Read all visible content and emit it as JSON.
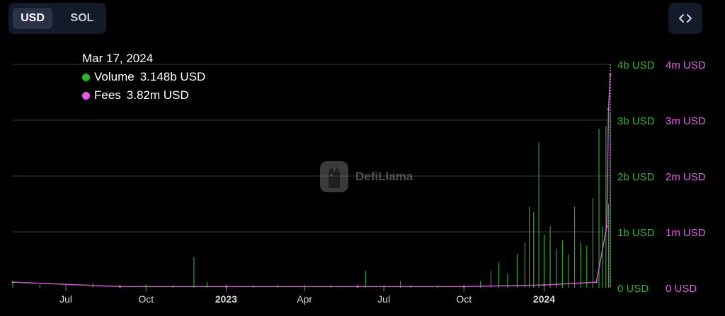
{
  "toggle": {
    "usd_label": "USD",
    "sol_label": "SOL",
    "active": "USD"
  },
  "embed_icon": "code-brackets-icon",
  "tooltip": {
    "date": "Mar 17, 2024",
    "volume_label": "Volume",
    "volume_value": "3.148b USD",
    "fees_label": "Fees",
    "fees_value": "3.82m USD"
  },
  "watermark": {
    "text": "DefiLlama",
    "icon": "llama-logo-icon"
  },
  "colors": {
    "volume": "#22b82a",
    "fees": "#e65ce6",
    "grid": "#3a3a3a",
    "background": "#000000"
  },
  "chart_data": {
    "type": "bar",
    "x_start": "2022-05-01",
    "x_end": "2024-03-17",
    "x_tick_labels": [
      "Jul",
      "Oct",
      "2023",
      "Apr",
      "Jul",
      "Oct",
      "2024"
    ],
    "x_tick_dates": [
      "2022-07-01",
      "2022-10-01",
      "2023-01-01",
      "2023-04-01",
      "2023-07-01",
      "2023-10-01",
      "2024-01-01"
    ],
    "y_left_ticks": [
      "0 USD",
      "1b USD",
      "2b USD",
      "3b USD",
      "4b USD"
    ],
    "y_right_ticks": [
      "0 USD",
      "1m USD",
      "2m USD",
      "3m USD",
      "4m USD"
    ],
    "y_left_range_usd": [
      0,
      4000000000
    ],
    "y_right_range_usd": [
      0,
      4000000
    ],
    "grid": true,
    "series": [
      {
        "name": "Volume",
        "axis": "left",
        "unit": "USD",
        "points": [
          [
            "2022-05-01",
            100000000.0
          ],
          [
            "2022-06-01",
            50000000.0
          ],
          [
            "2022-07-01",
            60000000.0
          ],
          [
            "2022-08-01",
            80000000.0
          ],
          [
            "2022-09-01",
            50000000.0
          ],
          [
            "2022-10-01",
            60000000.0
          ],
          [
            "2022-11-01",
            40000000.0
          ],
          [
            "2022-11-25",
            550000000.0
          ],
          [
            "2022-12-10",
            100000000.0
          ],
          [
            "2023-01-01",
            50000000.0
          ],
          [
            "2023-02-01",
            40000000.0
          ],
          [
            "2023-03-01",
            50000000.0
          ],
          [
            "2023-04-01",
            50000000.0
          ],
          [
            "2023-05-01",
            40000000.0
          ],
          [
            "2023-06-01",
            50000000.0
          ],
          [
            "2023-06-10",
            300000000.0
          ],
          [
            "2023-07-01",
            40000000.0
          ],
          [
            "2023-07-20",
            120000000.0
          ],
          [
            "2023-08-01",
            40000000.0
          ],
          [
            "2023-09-01",
            30000000.0
          ],
          [
            "2023-10-01",
            40000000.0
          ],
          [
            "2023-10-20",
            120000000.0
          ],
          [
            "2023-11-01",
            300000000.0
          ],
          [
            "2023-11-10",
            450000000.0
          ],
          [
            "2023-11-20",
            250000000.0
          ],
          [
            "2023-12-01",
            600000000.0
          ],
          [
            "2023-12-10",
            800000000.0
          ],
          [
            "2023-12-15",
            1450000000.0
          ],
          [
            "2023-12-20",
            1350000000.0
          ],
          [
            "2023-12-26",
            2600000000.0
          ],
          [
            "2024-01-01",
            950000000.0
          ],
          [
            "2024-01-08",
            1100000000.0
          ],
          [
            "2024-01-15",
            700000000.0
          ],
          [
            "2024-01-22",
            850000000.0
          ],
          [
            "2024-01-29",
            600000000.0
          ],
          [
            "2024-02-05",
            1450000000.0
          ],
          [
            "2024-02-12",
            800000000.0
          ],
          [
            "2024-02-19",
            750000000.0
          ],
          [
            "2024-02-26",
            1600000000.0
          ],
          [
            "2024-03-04",
            2850000000.0
          ],
          [
            "2024-03-08",
            1100000000.0
          ],
          [
            "2024-03-12",
            2900000000.0
          ],
          [
            "2024-03-15",
            1500000000.0
          ],
          [
            "2024-03-17",
            3148000000.0
          ]
        ]
      },
      {
        "name": "Fees",
        "axis": "right",
        "unit": "USD",
        "points": [
          [
            "2022-05-01",
            100000.0
          ],
          [
            "2022-09-01",
            20000.0
          ],
          [
            "2023-01-01",
            20000.0
          ],
          [
            "2023-06-01",
            20000.0
          ],
          [
            "2023-10-01",
            20000.0
          ],
          [
            "2024-01-01",
            50000.0
          ],
          [
            "2024-03-01",
            100000.0
          ],
          [
            "2024-03-13",
            1100000.0
          ],
          [
            "2024-03-15",
            3200000.0
          ],
          [
            "2024-03-17",
            3820000.0
          ]
        ]
      }
    ]
  }
}
